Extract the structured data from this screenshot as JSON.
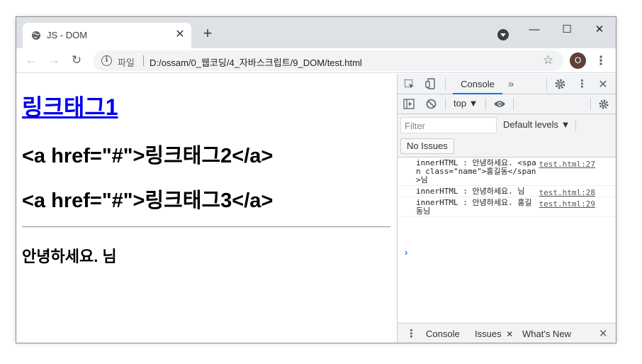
{
  "browser": {
    "tab_title": "JS - DOM",
    "tab_close": "✕",
    "new_tab": "+",
    "window_controls": {
      "minimize": "—",
      "maximize": "☐",
      "close": "✕"
    },
    "nav": {
      "back": "←",
      "forward": "→",
      "reload": "↻"
    },
    "omnibox": {
      "info_glyph": "i",
      "scheme_label": "파일",
      "url": "D:/ossam/0_웹코딩/4_자바스크립트/9_DOM/test.html"
    },
    "bookmark_star": "☆",
    "profile_initial": "O",
    "menu": "⋮"
  },
  "page": {
    "link1": "링크태그1",
    "line2": "<a href=\"#\">링크태그2</a>",
    "line3": "<a href=\"#\">링크태그3</a>",
    "greeting": "안녕하세요. 님"
  },
  "devtools": {
    "tabs": {
      "console": "Console",
      "more": "»"
    },
    "context": "top ▼",
    "filter_placeholder": "Filter",
    "levels": "Default levels ▼",
    "no_issues": "No Issues",
    "messages": [
      {
        "text": "innerHTML : 안녕하세요. <span class=\"name\">홍길동</span>님",
        "source": "test.html:27"
      },
      {
        "text": "innerHTML : 안녕하세요. 님",
        "source": "test.html:28"
      },
      {
        "text": "innerHTML : 안녕하세요. 홍길동님",
        "source": "test.html:29"
      }
    ],
    "prompt": "›",
    "drawer": {
      "menu": "⋮",
      "console": "Console",
      "issues": "Issues",
      "issues_close": "✕",
      "whats_new": "What's New",
      "close": "✕"
    }
  }
}
